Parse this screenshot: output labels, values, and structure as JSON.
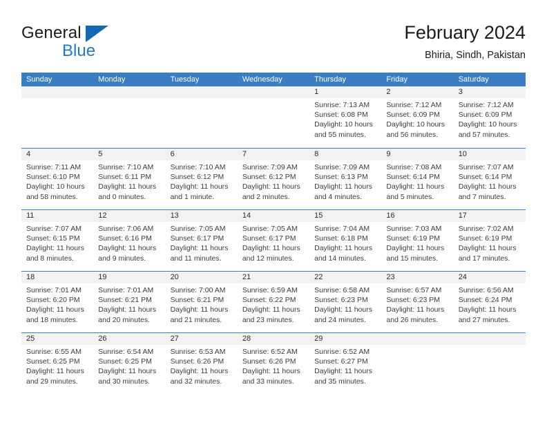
{
  "brand": {
    "name_top": "General",
    "name_bottom": "Blue",
    "accent_color": "#1268b3",
    "blue_text_color": "#1f7ac4"
  },
  "header": {
    "title": "February 2024",
    "subtitle": "Bhiria, Sindh, Pakistan"
  },
  "calendar": {
    "header_bg": "#3b7dc2",
    "daynum_bg": "#f2f2f2",
    "weekdays": [
      "Sunday",
      "Monday",
      "Tuesday",
      "Wednesday",
      "Thursday",
      "Friday",
      "Saturday"
    ],
    "weeks": [
      [
        {
          "day": "",
          "sunrise": "",
          "sunset": "",
          "daylight": ""
        },
        {
          "day": "",
          "sunrise": "",
          "sunset": "",
          "daylight": ""
        },
        {
          "day": "",
          "sunrise": "",
          "sunset": "",
          "daylight": ""
        },
        {
          "day": "",
          "sunrise": "",
          "sunset": "",
          "daylight": ""
        },
        {
          "day": "1",
          "sunrise": "Sunrise: 7:13 AM",
          "sunset": "Sunset: 6:08 PM",
          "daylight": "Daylight: 10 hours and 55 minutes."
        },
        {
          "day": "2",
          "sunrise": "Sunrise: 7:12 AM",
          "sunset": "Sunset: 6:09 PM",
          "daylight": "Daylight: 10 hours and 56 minutes."
        },
        {
          "day": "3",
          "sunrise": "Sunrise: 7:12 AM",
          "sunset": "Sunset: 6:09 PM",
          "daylight": "Daylight: 10 hours and 57 minutes."
        }
      ],
      [
        {
          "day": "4",
          "sunrise": "Sunrise: 7:11 AM",
          "sunset": "Sunset: 6:10 PM",
          "daylight": "Daylight: 10 hours and 58 minutes."
        },
        {
          "day": "5",
          "sunrise": "Sunrise: 7:10 AM",
          "sunset": "Sunset: 6:11 PM",
          "daylight": "Daylight: 11 hours and 0 minutes."
        },
        {
          "day": "6",
          "sunrise": "Sunrise: 7:10 AM",
          "sunset": "Sunset: 6:12 PM",
          "daylight": "Daylight: 11 hours and 1 minute."
        },
        {
          "day": "7",
          "sunrise": "Sunrise: 7:09 AM",
          "sunset": "Sunset: 6:12 PM",
          "daylight": "Daylight: 11 hours and 2 minutes."
        },
        {
          "day": "8",
          "sunrise": "Sunrise: 7:09 AM",
          "sunset": "Sunset: 6:13 PM",
          "daylight": "Daylight: 11 hours and 4 minutes."
        },
        {
          "day": "9",
          "sunrise": "Sunrise: 7:08 AM",
          "sunset": "Sunset: 6:14 PM",
          "daylight": "Daylight: 11 hours and 5 minutes."
        },
        {
          "day": "10",
          "sunrise": "Sunrise: 7:07 AM",
          "sunset": "Sunset: 6:14 PM",
          "daylight": "Daylight: 11 hours and 7 minutes."
        }
      ],
      [
        {
          "day": "11",
          "sunrise": "Sunrise: 7:07 AM",
          "sunset": "Sunset: 6:15 PM",
          "daylight": "Daylight: 11 hours and 8 minutes."
        },
        {
          "day": "12",
          "sunrise": "Sunrise: 7:06 AM",
          "sunset": "Sunset: 6:16 PM",
          "daylight": "Daylight: 11 hours and 9 minutes."
        },
        {
          "day": "13",
          "sunrise": "Sunrise: 7:05 AM",
          "sunset": "Sunset: 6:17 PM",
          "daylight": "Daylight: 11 hours and 11 minutes."
        },
        {
          "day": "14",
          "sunrise": "Sunrise: 7:05 AM",
          "sunset": "Sunset: 6:17 PM",
          "daylight": "Daylight: 11 hours and 12 minutes."
        },
        {
          "day": "15",
          "sunrise": "Sunrise: 7:04 AM",
          "sunset": "Sunset: 6:18 PM",
          "daylight": "Daylight: 11 hours and 14 minutes."
        },
        {
          "day": "16",
          "sunrise": "Sunrise: 7:03 AM",
          "sunset": "Sunset: 6:19 PM",
          "daylight": "Daylight: 11 hours and 15 minutes."
        },
        {
          "day": "17",
          "sunrise": "Sunrise: 7:02 AM",
          "sunset": "Sunset: 6:19 PM",
          "daylight": "Daylight: 11 hours and 17 minutes."
        }
      ],
      [
        {
          "day": "18",
          "sunrise": "Sunrise: 7:01 AM",
          "sunset": "Sunset: 6:20 PM",
          "daylight": "Daylight: 11 hours and 18 minutes."
        },
        {
          "day": "19",
          "sunrise": "Sunrise: 7:01 AM",
          "sunset": "Sunset: 6:21 PM",
          "daylight": "Daylight: 11 hours and 20 minutes."
        },
        {
          "day": "20",
          "sunrise": "Sunrise: 7:00 AM",
          "sunset": "Sunset: 6:21 PM",
          "daylight": "Daylight: 11 hours and 21 minutes."
        },
        {
          "day": "21",
          "sunrise": "Sunrise: 6:59 AM",
          "sunset": "Sunset: 6:22 PM",
          "daylight": "Daylight: 11 hours and 23 minutes."
        },
        {
          "day": "22",
          "sunrise": "Sunrise: 6:58 AM",
          "sunset": "Sunset: 6:23 PM",
          "daylight": "Daylight: 11 hours and 24 minutes."
        },
        {
          "day": "23",
          "sunrise": "Sunrise: 6:57 AM",
          "sunset": "Sunset: 6:23 PM",
          "daylight": "Daylight: 11 hours and 26 minutes."
        },
        {
          "day": "24",
          "sunrise": "Sunrise: 6:56 AM",
          "sunset": "Sunset: 6:24 PM",
          "daylight": "Daylight: 11 hours and 27 minutes."
        }
      ],
      [
        {
          "day": "25",
          "sunrise": "Sunrise: 6:55 AM",
          "sunset": "Sunset: 6:25 PM",
          "daylight": "Daylight: 11 hours and 29 minutes."
        },
        {
          "day": "26",
          "sunrise": "Sunrise: 6:54 AM",
          "sunset": "Sunset: 6:25 PM",
          "daylight": "Daylight: 11 hours and 30 minutes."
        },
        {
          "day": "27",
          "sunrise": "Sunrise: 6:53 AM",
          "sunset": "Sunset: 6:26 PM",
          "daylight": "Daylight: 11 hours and 32 minutes."
        },
        {
          "day": "28",
          "sunrise": "Sunrise: 6:52 AM",
          "sunset": "Sunset: 6:26 PM",
          "daylight": "Daylight: 11 hours and 33 minutes."
        },
        {
          "day": "29",
          "sunrise": "Sunrise: 6:52 AM",
          "sunset": "Sunset: 6:27 PM",
          "daylight": "Daylight: 11 hours and 35 minutes."
        },
        {
          "day": "",
          "sunrise": "",
          "sunset": "",
          "daylight": ""
        },
        {
          "day": "",
          "sunrise": "",
          "sunset": "",
          "daylight": ""
        }
      ]
    ]
  }
}
